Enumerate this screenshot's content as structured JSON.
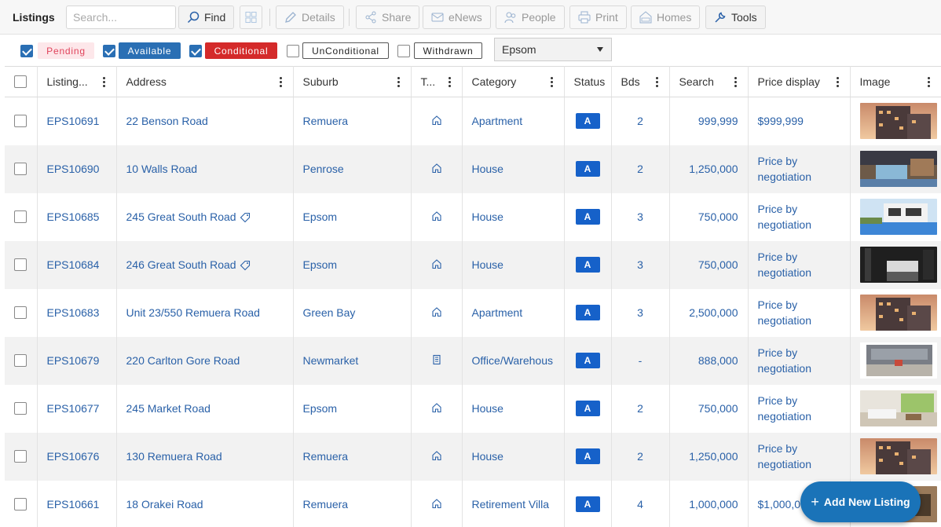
{
  "toolbar": {
    "title": "Listings",
    "search_placeholder": "Search...",
    "find_label": "Find",
    "details_label": "Details",
    "share_label": "Share",
    "enews_label": "eNews",
    "people_label": "People",
    "print_label": "Print",
    "homes_label": "Homes",
    "tools_label": "Tools"
  },
  "filters": {
    "pending": {
      "label": "Pending",
      "checked": true
    },
    "available": {
      "label": "Available",
      "checked": true
    },
    "conditional": {
      "label": "Conditional",
      "checked": true
    },
    "unconditional": {
      "label": "UnConditional",
      "checked": false
    },
    "withdrawn": {
      "label": "Withdrawn",
      "checked": false
    },
    "office_select": "Epsom"
  },
  "columns": {
    "listing": "Listing...",
    "address": "Address",
    "suburb": "Suburb",
    "type": "T...",
    "category": "Category",
    "status": "Status",
    "beds": "Bds",
    "search": "Search",
    "price_display": "Price display",
    "image": "Image"
  },
  "rows": [
    {
      "id": "EPS10691",
      "address": "22 Benson Road",
      "tagged": false,
      "suburb": "Remuera",
      "type_icon": "house-icon",
      "category": "Apartment",
      "status": "A",
      "beds": "2",
      "search": "999,999",
      "price": "$999,999",
      "image": "apartment-dusk"
    },
    {
      "id": "EPS10690",
      "address": "10 Walls Road",
      "tagged": false,
      "suburb": "Penrose",
      "type_icon": "house-icon",
      "category": "House",
      "status": "A",
      "beds": "2",
      "search": "1,250,000",
      "price": "Price by negotiation",
      "image": "pool-deck"
    },
    {
      "id": "EPS10685",
      "address": "245 Great South Road",
      "tagged": true,
      "suburb": "Epsom",
      "type_icon": "house-icon",
      "category": "House",
      "status": "A",
      "beds": "3",
      "search": "750,000",
      "price": "Price by negotiation",
      "image": "pool-house"
    },
    {
      "id": "EPS10684",
      "address": "246 Great South Road",
      "tagged": true,
      "suburb": "Epsom",
      "type_icon": "house-icon",
      "category": "House",
      "status": "A",
      "beds": "3",
      "search": "750,000",
      "price": "Price by negotiation",
      "image": "dark-kitchen"
    },
    {
      "id": "EPS10683",
      "address": "Unit 23/550 Remuera Road",
      "tagged": false,
      "suburb": "Green Bay",
      "type_icon": "house-icon",
      "category": "Apartment",
      "status": "A",
      "beds": "3",
      "search": "2,500,000",
      "price": "Price by negotiation",
      "image": "apartment-dusk"
    },
    {
      "id": "EPS10679",
      "address": "220 Carlton Gore Road",
      "tagged": false,
      "suburb": "Newmarket",
      "type_icon": "building-icon",
      "category": "Office/Warehous",
      "status": "A",
      "beds": "-",
      "search": "888,000",
      "price": "Price by negotiation",
      "image": "warehouse"
    },
    {
      "id": "EPS10677",
      "address": "245 Market Road",
      "tagged": false,
      "suburb": "Epsom",
      "type_icon": "house-icon",
      "category": "House",
      "status": "A",
      "beds": "2",
      "search": "750,000",
      "price": "Price by negotiation",
      "image": "living-room"
    },
    {
      "id": "EPS10676",
      "address": "130 Remuera Road",
      "tagged": false,
      "suburb": "Remuera",
      "type_icon": "house-icon",
      "category": "House",
      "status": "A",
      "beds": "2",
      "search": "1,250,000",
      "price": "Price by negotiation",
      "image": "apartment-dusk"
    },
    {
      "id": "EPS10661",
      "address": "18 Orakei Road",
      "tagged": false,
      "suburb": "Remuera",
      "type_icon": "house-icon",
      "category": "Retirement Villa",
      "status": "A",
      "beds": "4",
      "search": "1,000,000",
      "price": "$1,000,0",
      "image": "interior"
    }
  ],
  "fab_label": "Add New Listing",
  "colors": {
    "link": "#2a61a8",
    "status_badge": "#1661c9",
    "fab": "#1a73b8",
    "pending_text": "#e0445c",
    "available": "#2a6fb4",
    "conditional": "#d42a2a"
  }
}
